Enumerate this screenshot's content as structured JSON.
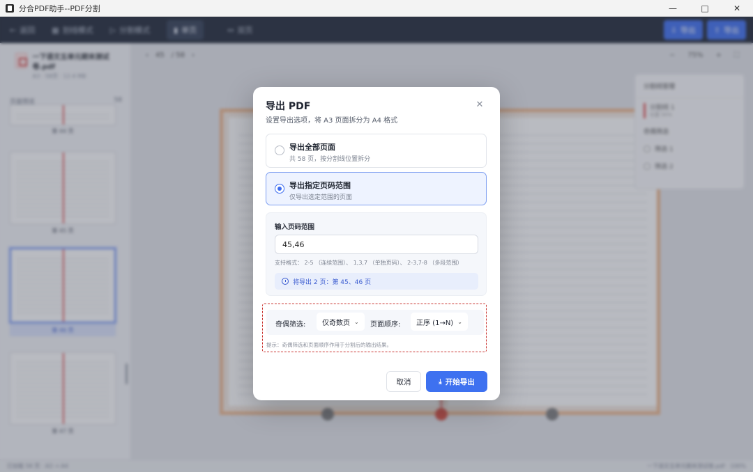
{
  "window": {
    "title": "分合PDF助手--PDF分割",
    "controls": [
      "minimize",
      "maximize",
      "close"
    ]
  },
  "toolbar": {
    "back": "返回",
    "items": [
      "划线模式",
      "分割模式"
    ],
    "tabs": [
      "单页",
      "双页"
    ],
    "right_buttons": [
      "导出",
      "导出"
    ]
  },
  "sidebar": {
    "doc_name": "一下语文五单元期末测试卷.pdf",
    "doc_meta": "A3 · 58页 · 12.4 MB",
    "thumbs_label": "页面预览",
    "thumbs_count": "58",
    "thumbs": [
      {
        "label": "第 44 页"
      },
      {
        "label": "第 45 页"
      },
      {
        "label": "第 46 页",
        "selected": true
      },
      {
        "label": "第 47 页"
      }
    ]
  },
  "viewer": {
    "page_input": "45",
    "page_total": "/ 58",
    "zoom": "75%",
    "right_panel": {
      "title": "分割线管理",
      "line": "分割线 1",
      "line_meta": "位置 50%",
      "section": "奇偶筛选",
      "options": [
        "筛选 1",
        "筛选 2"
      ]
    }
  },
  "statusbar": {
    "left": "已加载 58 页 · A3 → A4",
    "right": "一下语文五单元期末测试卷.pdf · 100%"
  },
  "modal": {
    "title": "导出 PDF",
    "subtitle": "设置导出选项，将 A3 页面拆分为 A4 格式",
    "close_icon": "close-icon",
    "options": [
      {
        "label": "导出全部页面",
        "desc": "共 58 页，按分割线位置拆分",
        "selected": false
      },
      {
        "label": "导出指定页码范围",
        "desc": "仅导出选定范围的页面",
        "selected": true
      }
    ],
    "range": {
      "title": "输入页码范围",
      "value": "45,46",
      "placeholder": "例如：1-5, 8, 10-12",
      "hint": "支持格式： 2-5 （连续范围）、 1,3,7 （单独页码）、 2-3,7-8 （多段范围）",
      "result": "将导出 2 页：第 45、46 页"
    },
    "filter": {
      "parity_label": "奇偶筛选:",
      "parity_value": "仅奇数页",
      "order_label": "页面顺序:",
      "order_value": "正序 (1→N)",
      "tip": "提示：奇偶筛选和页面顺序作用于分割后的输出结果。"
    },
    "buttons": {
      "cancel": "取消",
      "export": "开始导出"
    }
  },
  "colors": {
    "accent": "#3e71f0",
    "toolbar_bg": "#1c2434",
    "highlight_border": "#c9302c",
    "split_line": "#e05252"
  }
}
